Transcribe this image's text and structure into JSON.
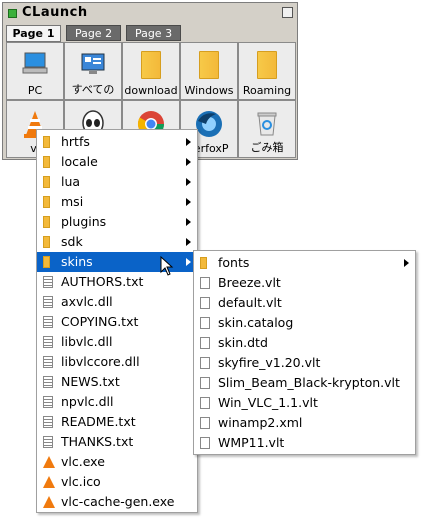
{
  "window": {
    "title": "CLaunch"
  },
  "tabs": [
    "Page 1",
    "Page 2",
    "Page 3"
  ],
  "grid_row1": [
    {
      "label": "PC"
    },
    {
      "label": "すべての"
    },
    {
      "label": "download"
    },
    {
      "label": "Windows"
    },
    {
      "label": "Roaming"
    }
  ],
  "grid_row2": [
    {
      "label": "vl"
    },
    {
      "label": ""
    },
    {
      "label": ""
    },
    {
      "label": "terfoxP"
    },
    {
      "label": "ごみ箱"
    }
  ],
  "menu1": [
    {
      "label": "hrtfs",
      "type": "folder",
      "sub": true
    },
    {
      "label": "locale",
      "type": "folder",
      "sub": true
    },
    {
      "label": "lua",
      "type": "folder",
      "sub": true
    },
    {
      "label": "msi",
      "type": "folder",
      "sub": true
    },
    {
      "label": "plugins",
      "type": "folder",
      "sub": true
    },
    {
      "label": "sdk",
      "type": "folder",
      "sub": true
    },
    {
      "label": "skins",
      "type": "folder",
      "sub": true,
      "selected": true
    },
    {
      "label": "AUTHORS.txt",
      "type": "txt"
    },
    {
      "label": "axvlc.dll",
      "type": "txt"
    },
    {
      "label": "COPYING.txt",
      "type": "txt"
    },
    {
      "label": "libvlc.dll",
      "type": "txt"
    },
    {
      "label": "libvlccore.dll",
      "type": "txt"
    },
    {
      "label": "NEWS.txt",
      "type": "txt"
    },
    {
      "label": "npvlc.dll",
      "type": "txt"
    },
    {
      "label": "README.txt",
      "type": "txt"
    },
    {
      "label": "THANKS.txt",
      "type": "txt"
    },
    {
      "label": "vlc.exe",
      "type": "cone"
    },
    {
      "label": "vlc.ico",
      "type": "cone"
    },
    {
      "label": "vlc-cache-gen.exe",
      "type": "cone"
    }
  ],
  "menu2": [
    {
      "label": "fonts",
      "type": "folder",
      "sub": true
    },
    {
      "label": "Breeze.vlt",
      "type": "doc"
    },
    {
      "label": "default.vlt",
      "type": "doc"
    },
    {
      "label": "skin.catalog",
      "type": "doc"
    },
    {
      "label": "skin.dtd",
      "type": "doc"
    },
    {
      "label": "skyfire_v1.20.vlt",
      "type": "doc"
    },
    {
      "label": "Slim_Beam_Black-krypton.vlt",
      "type": "doc"
    },
    {
      "label": "Win_VLC_1.1.vlt",
      "type": "doc"
    },
    {
      "label": "winamp2.xml",
      "type": "doc"
    },
    {
      "label": "WMP11.vlt",
      "type": "doc"
    }
  ]
}
